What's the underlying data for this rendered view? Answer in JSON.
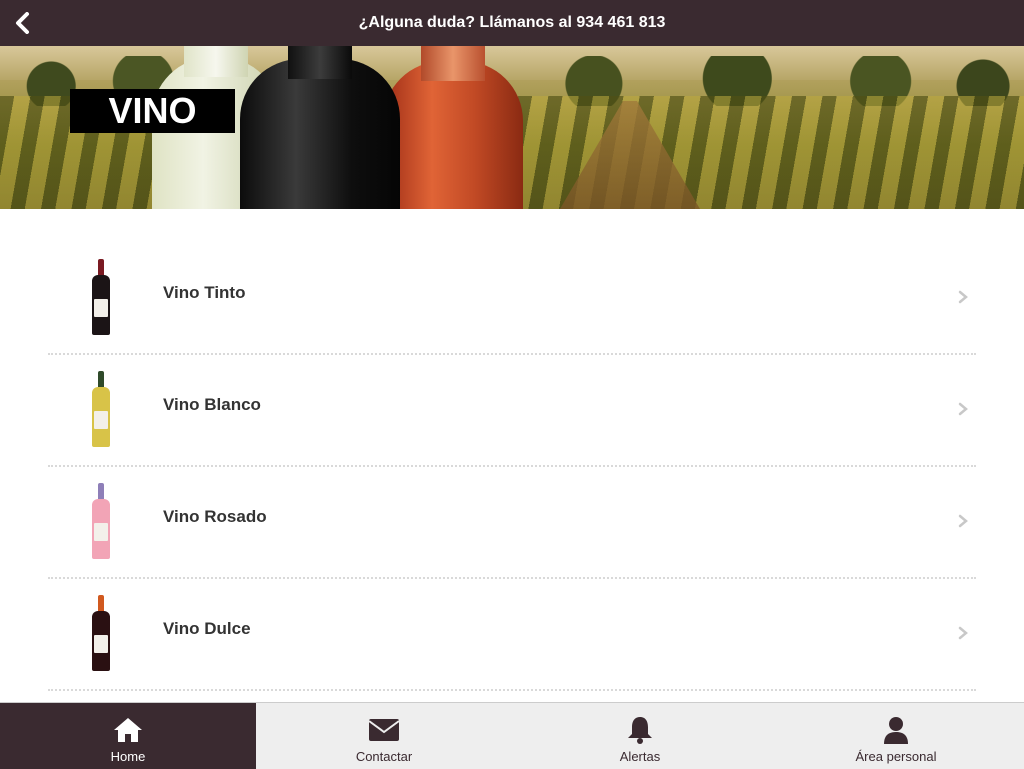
{
  "header": {
    "title": "¿Alguna duda? Llámanos al 934 461 813",
    "back_icon": "chevron-left-icon"
  },
  "banner": {
    "label": "VINO"
  },
  "list": {
    "items": [
      {
        "label": "Vino Tinto",
        "icon": "chevron-right-icon"
      },
      {
        "label": "Vino Blanco",
        "icon": "chevron-right-icon"
      },
      {
        "label": "Vino Rosado",
        "icon": "chevron-right-icon"
      },
      {
        "label": "Vino Dulce",
        "icon": "chevron-right-icon"
      }
    ]
  },
  "tabs": [
    {
      "label": "Home",
      "icon": "home-icon",
      "active": true
    },
    {
      "label": "Contactar",
      "icon": "envelope-icon",
      "active": false
    },
    {
      "label": "Alertas",
      "icon": "bell-icon",
      "active": false
    },
    {
      "label": "Área personal",
      "icon": "user-icon",
      "active": false
    }
  ],
  "colors": {
    "brand": "#3a2a30",
    "tab_background": "#eeeeee",
    "text": "#333333"
  }
}
